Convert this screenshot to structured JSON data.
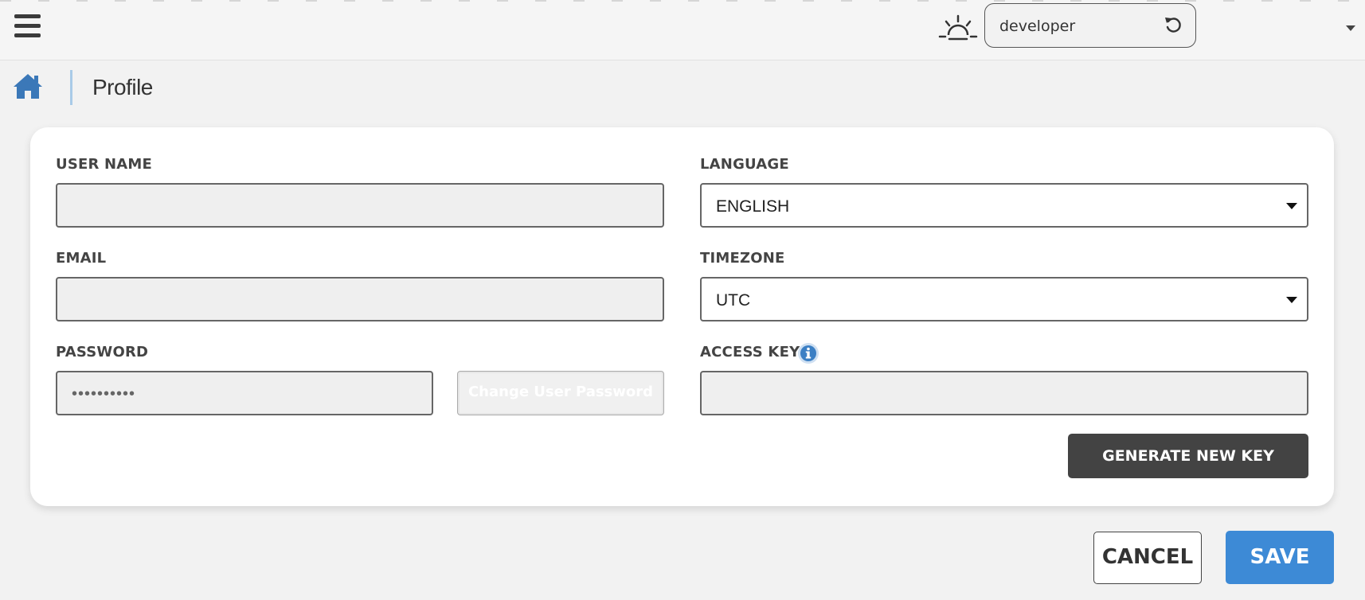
{
  "header": {
    "menu_icon": "hamburger-menu-icon",
    "theme_icon": "sunrise-icon",
    "environment": {
      "label": "developer",
      "icon": "refresh-icon"
    },
    "user_menu_icon": "caret-down-icon"
  },
  "breadcrumb": {
    "home_icon": "home-icon",
    "title": "Profile"
  },
  "form": {
    "username": {
      "label": "USER NAME",
      "value": ""
    },
    "email": {
      "label": "EMAIL",
      "value": ""
    },
    "password": {
      "label": "PASSWORD",
      "value": "••••••••••",
      "change_button": "Change User Password"
    },
    "language": {
      "label": "LANGUAGE",
      "value": "ENGLISH"
    },
    "timezone": {
      "label": "TIMEZONE",
      "value": "UTC"
    },
    "access_key": {
      "label": "ACCESS KEY",
      "value": "",
      "info_icon": "info-icon"
    },
    "generate_button": "GENERATE NEW KEY"
  },
  "actions": {
    "cancel": "CANCEL",
    "save": "SAVE"
  },
  "colors": {
    "primary": "#3d8ad6",
    "dark_button": "#434343",
    "home_icon": "#3b78b8"
  }
}
